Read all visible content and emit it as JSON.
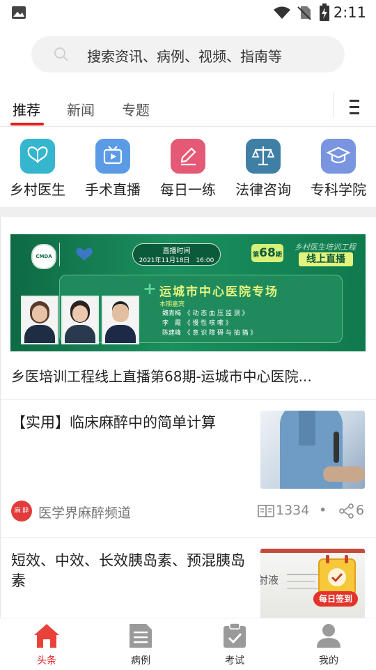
{
  "status": {
    "time": "2:11"
  },
  "search": {
    "placeholder": "搜索资讯、病例、视频、指南等"
  },
  "tabs": [
    {
      "label": "推荐"
    },
    {
      "label": "新闻"
    },
    {
      "label": "专题"
    }
  ],
  "categories": [
    {
      "label": "乡村医生",
      "icon": "butterfly-icon",
      "color": "#35b6ce"
    },
    {
      "label": "手术直播",
      "icon": "tv-icon",
      "color": "#5b9be6"
    },
    {
      "label": "每日一练",
      "icon": "pencil-icon",
      "color": "#e45a76"
    },
    {
      "label": "法律咨询",
      "icon": "scales-icon",
      "color": "#3f7fa6"
    },
    {
      "label": "专科学院",
      "icon": "graduation-cap-icon",
      "color": "#7a95e0"
    }
  ],
  "banner": {
    "cmda": "CMDA",
    "time_label": "直播时间",
    "time_value": "2021年11月18日　16:00",
    "issue_prefix": "第",
    "issue_num": "68",
    "issue_suffix": "期",
    "program_name": "乡村医生培训工程",
    "live_badge": "线上直播",
    "venue": "运城市中心医院专场",
    "guests_label": "本期嘉宾",
    "guests": [
      {
        "name": "魏青梅",
        "topic": "《 动 态 血 压 监 测 》"
      },
      {
        "name": "李　霞",
        "topic": "《 慢 性 咳 嗽 》"
      },
      {
        "name": "陈建峰",
        "topic": "《 意 识 障 碍 与 抽 搐 》"
      }
    ],
    "caption": "乡医培训工程线上直播第68期-运城市中心医院..."
  },
  "articles": [
    {
      "title": "【实用】临床麻醉中的简单计算",
      "source": "医学界麻醉频道",
      "source_logo": "麻 醉",
      "reads": "1334",
      "separator": "•",
      "shares": "6"
    },
    {
      "title": "短效、中效、长效胰岛素、预混胰岛素",
      "thumb_text": "射液",
      "badge": "每日签到"
    }
  ],
  "bottom_nav": [
    {
      "label": "头条",
      "icon": "home-icon",
      "active": true
    },
    {
      "label": "病例",
      "icon": "case-file-icon"
    },
    {
      "label": "考试",
      "icon": "exam-clipboard-icon"
    },
    {
      "label": "我的",
      "icon": "user-icon"
    }
  ],
  "colors": {
    "accent": "#e02020",
    "nav_inactive": "#888888"
  }
}
